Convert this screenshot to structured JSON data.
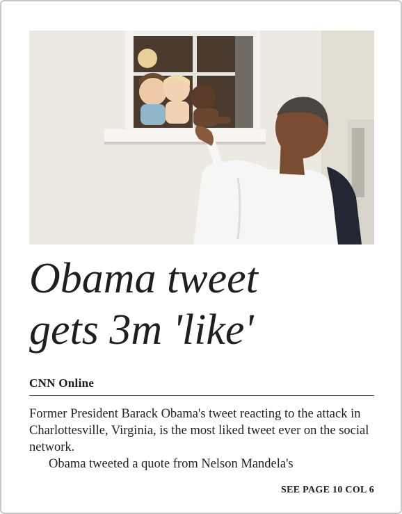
{
  "article": {
    "headline_line1": "Obama tweet",
    "headline_line2": "gets 3m 'like'",
    "byline": "CNN Online",
    "paragraph1": "Former President Barack Obama's tweet reacting to the attack in Charlottesville, Virginia, is the most liked tweet ever on the social network.",
    "paragraph2": "Obama tweeted a quote from Nelson Mandela's",
    "jump_line": "SEE PAGE 10 COL 6"
  },
  "colors": {
    "text": "#1f1f1f",
    "wall": "#ece9e2",
    "shirt": "#f6f6f4",
    "window_dark": "#4a3b2e"
  }
}
